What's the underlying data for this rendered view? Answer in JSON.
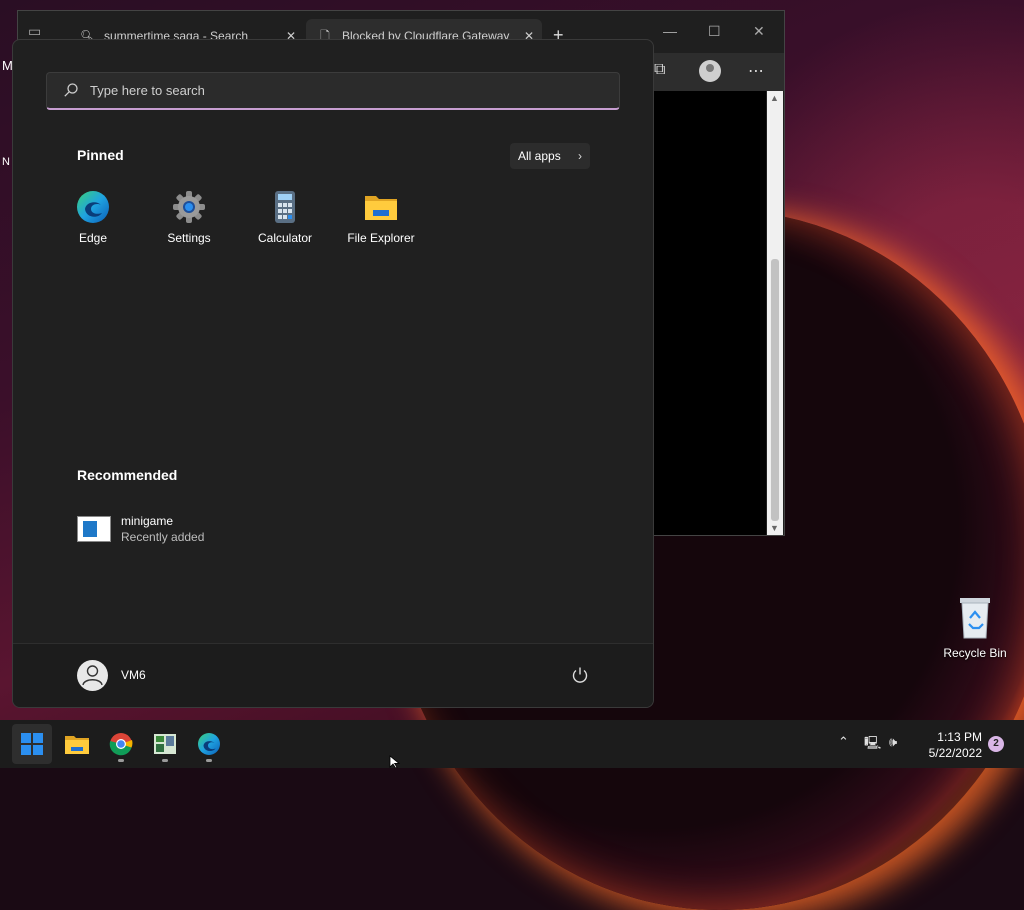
{
  "browser": {
    "tabs": [
      {
        "label": "summertime saga - Search",
        "icon": "search-icon"
      },
      {
        "label": "Blocked by Cloudflare Gateway",
        "icon": "document-icon"
      }
    ],
    "new_tab": "+"
  },
  "left_stub": {
    "m1": "M",
    "m2": "N"
  },
  "start": {
    "search_placeholder": "Type here to search",
    "pinned_title": "Pinned",
    "all_apps_label": "All apps",
    "pinned_apps": [
      {
        "label": "Edge",
        "icon": "edge-icon"
      },
      {
        "label": "Settings",
        "icon": "settings-gear-icon"
      },
      {
        "label": "Calculator",
        "icon": "calculator-icon"
      },
      {
        "label": "File Explorer",
        "icon": "folder-icon"
      }
    ],
    "recommended_title": "Recommended",
    "recommended": [
      {
        "name": "minigame",
        "subtitle": "Recently added"
      }
    ],
    "user_name": "VM6"
  },
  "desktop": {
    "recycle_bin_label": "Recycle Bin"
  },
  "taskbar": {
    "apps": [
      "windows-start-icon",
      "file-explorer-icon",
      "chrome-icon",
      "minigame-icon",
      "edge-icon"
    ],
    "time": "1:13 PM",
    "date": "5/22/2022",
    "notification_count": "2"
  },
  "colors": {
    "start_bg": "#202020",
    "search_accent": "#c79ed1",
    "taskbar_bg": "#1c1c1c",
    "windows_blue": "#2b8ff0"
  }
}
